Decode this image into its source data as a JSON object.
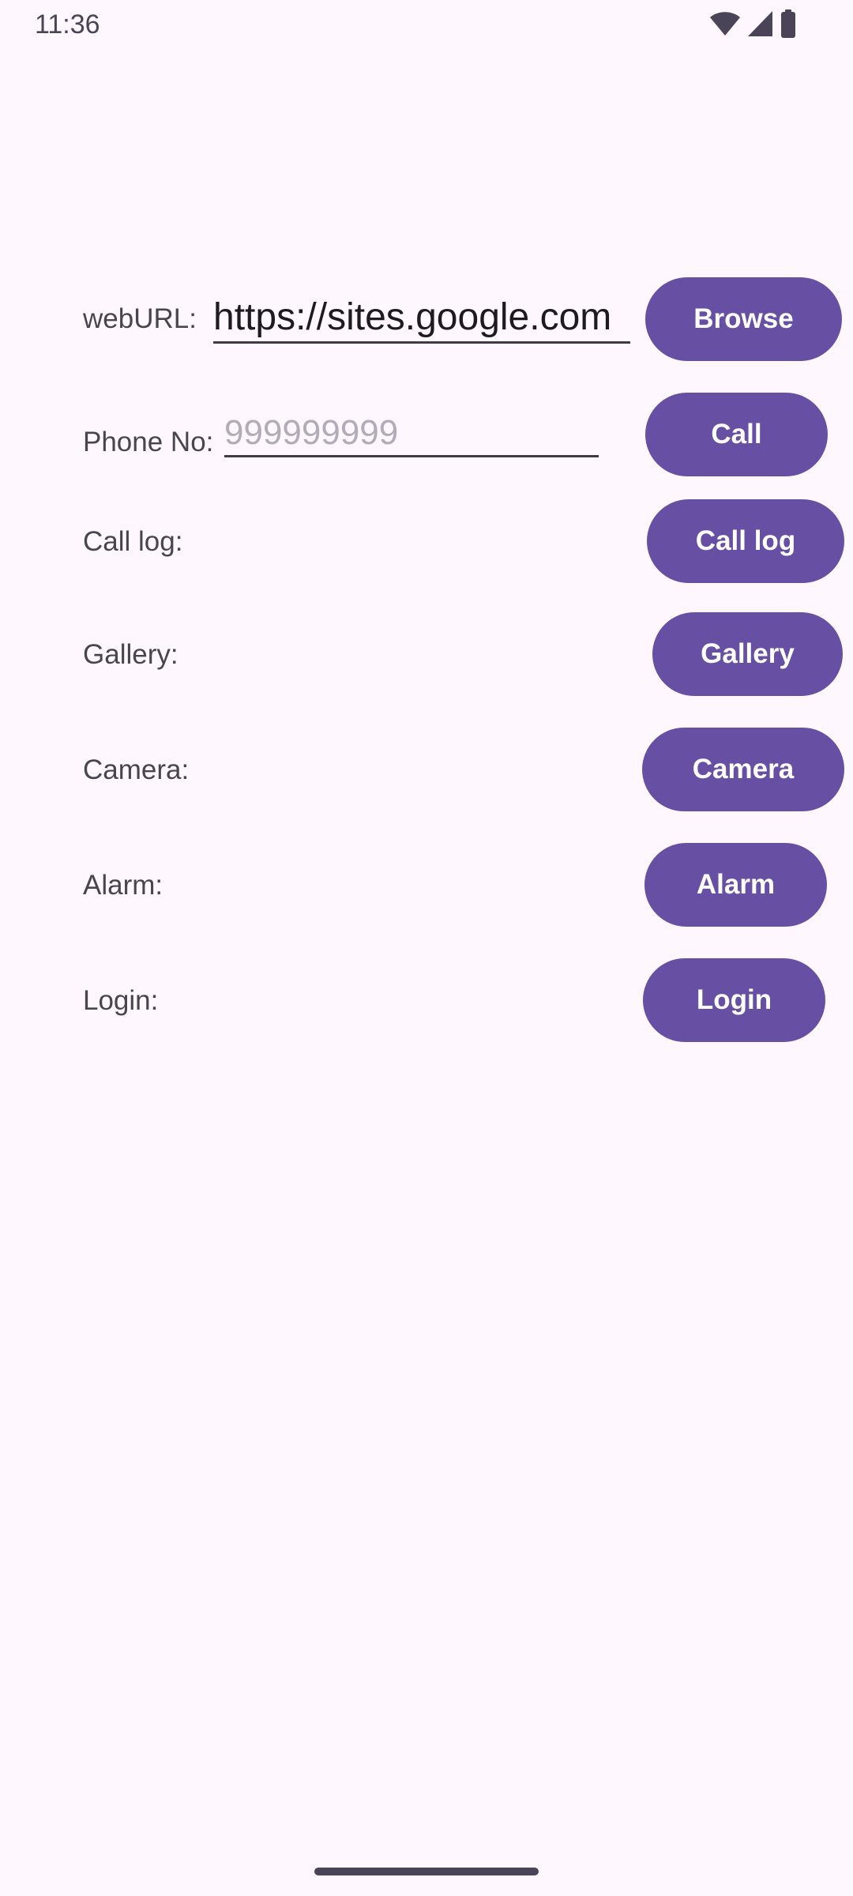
{
  "status_bar": {
    "time": "11:36",
    "icons": [
      "wifi-icon",
      "cellular-signal-icon",
      "battery-icon"
    ]
  },
  "rows": {
    "web": {
      "label": "webURL:",
      "value": "https://sites.google.com",
      "button": "Browse"
    },
    "phone": {
      "label": "Phone No:",
      "value": "",
      "placeholder": "999999999",
      "button": "Call"
    },
    "call_log": {
      "label": "Call log:",
      "button": "Call log"
    },
    "gallery": {
      "label": "Gallery:",
      "button": "Gallery"
    },
    "camera": {
      "label": "Camera:",
      "button": "Camera"
    },
    "alarm": {
      "label": "Alarm:",
      "button": "Alarm"
    },
    "login": {
      "label": "Login:",
      "button": "Login"
    }
  },
  "colors": {
    "background": "#FEF7FE",
    "button": "#6750A4",
    "button_text": "#FFFFFF",
    "label_text": "#49454F"
  }
}
